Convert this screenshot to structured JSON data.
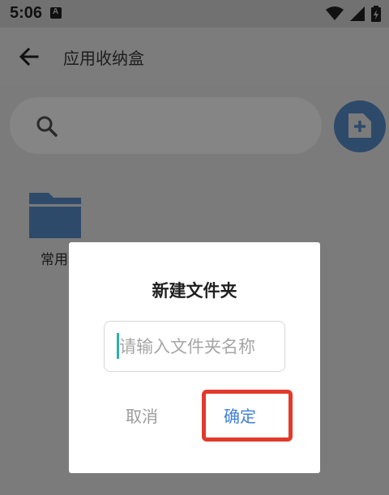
{
  "status_bar": {
    "time": "5:06",
    "icons": [
      "notification-icon",
      "wifi-icon",
      "signal-icon",
      "battery-icon"
    ]
  },
  "app_bar": {
    "title": "应用收纳盒",
    "back_icon": "arrow-left-icon"
  },
  "search": {
    "icon": "search-icon",
    "placeholder": ""
  },
  "fab": {
    "icon": "add-file-icon",
    "color": "#2e4a6a"
  },
  "folders": [
    {
      "label": "常用",
      "icon": "folder-icon",
      "color": "#2e4a6a"
    }
  ],
  "dialog": {
    "title": "新建文件夹",
    "input": {
      "value": "",
      "placeholder": "请输入文件夹名称"
    },
    "cancel_label": "取消",
    "confirm_label": "确定",
    "highlight_color": "#e23a2b",
    "confirm_color": "#3f80d8"
  }
}
